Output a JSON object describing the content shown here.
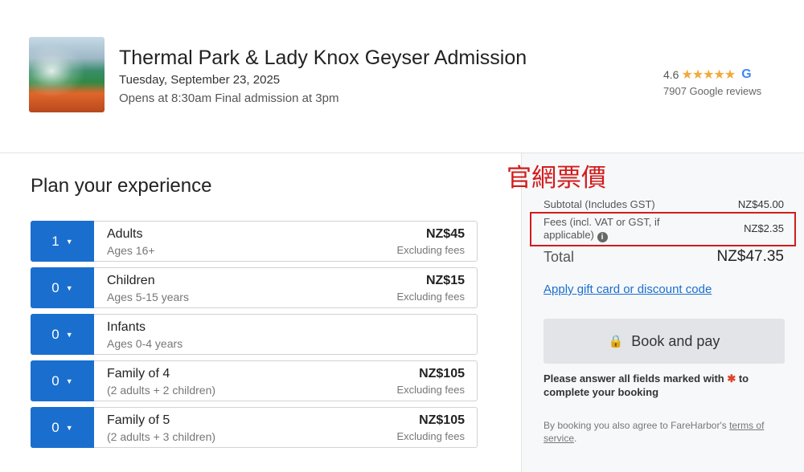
{
  "header": {
    "title": "Thermal Park & Lady Knox Geyser Admission",
    "date": "Tuesday, September 23, 2025",
    "hours": "Opens at 8:30am Final admission at 3pm",
    "rating": "4.6",
    "stars": "★★★★★",
    "google_letter": "G",
    "reviews": "7907 Google reviews"
  },
  "plan": {
    "title": "Plan your experience",
    "rows": [
      {
        "qty": "1",
        "name": "Adults",
        "sub": "Ages 16+",
        "price": "NZ$45",
        "fees": "Excluding fees"
      },
      {
        "qty": "0",
        "name": "Children",
        "sub": "Ages 5-15 years",
        "price": "NZ$15",
        "fees": "Excluding fees"
      },
      {
        "qty": "0",
        "name": "Infants",
        "sub": "Ages 0-4 years",
        "price": "",
        "fees": ""
      },
      {
        "qty": "0",
        "name": "Family of 4",
        "sub": "(2 adults + 2 children)",
        "price": "NZ$105",
        "fees": "Excluding fees"
      },
      {
        "qty": "0",
        "name": "Family of 5",
        "sub": "(2 adults + 3 children)",
        "price": "NZ$105",
        "fees": "Excluding fees"
      }
    ]
  },
  "annotation": "官網票價",
  "summary": {
    "subtotal_label": "Subtotal (Includes GST)",
    "subtotal_value": "NZ$45.00",
    "fees_label": "Fees (incl. VAT or GST, if applicable)",
    "fees_value": "NZ$2.35",
    "total_label": "Total",
    "total_value": "NZ$47.35",
    "gift_link": "Apply gift card or discount code",
    "book_button": "Book and pay",
    "notice_before": "Please answer all fields marked with ",
    "notice_after": " to complete your booking",
    "agree_before": "By booking you also agree to FareHarbor's ",
    "terms_link": "terms of service",
    "agree_after": "."
  },
  "colors": {
    "accent": "#1a6fce",
    "annotation_red": "#d11c1c",
    "star": "#f2a93b"
  }
}
